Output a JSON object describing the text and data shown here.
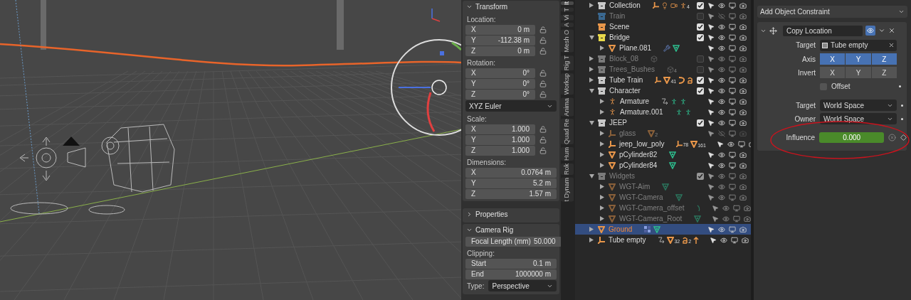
{
  "n_panel": {
    "panels": [
      {
        "title": "Transform",
        "expanded": true,
        "items": [
          {
            "kind": "label",
            "text": "Location:"
          },
          {
            "kind": "field",
            "label": "X",
            "value": "0 m",
            "locked": false
          },
          {
            "kind": "field",
            "label": "Y",
            "value": "-112.38 m",
            "locked": false
          },
          {
            "kind": "field",
            "label": "Z",
            "value": "0 m",
            "locked": false
          },
          {
            "kind": "label",
            "text": "Rotation:"
          },
          {
            "kind": "field",
            "label": "X",
            "value": "0°",
            "locked": false
          },
          {
            "kind": "field",
            "label": "Y",
            "value": "0°",
            "locked": false
          },
          {
            "kind": "field",
            "label": "Z",
            "value": "0°",
            "locked": false
          },
          {
            "kind": "dropdown",
            "value": "XYZ Euler"
          },
          {
            "kind": "label",
            "text": "Scale:"
          },
          {
            "kind": "field",
            "label": "X",
            "value": "1.000",
            "locked": false
          },
          {
            "kind": "field",
            "label": "Y",
            "value": "1.000",
            "locked": false
          },
          {
            "kind": "field",
            "label": "Z",
            "value": "1.000",
            "locked": false
          },
          {
            "kind": "label",
            "text": "Dimensions:"
          },
          {
            "kind": "field",
            "label": "X",
            "value": "0.0764 m"
          },
          {
            "kind": "field",
            "label": "Y",
            "value": "5.2 m"
          },
          {
            "kind": "field",
            "label": "Z",
            "value": "1.57 m"
          }
        ]
      },
      {
        "title": "Properties",
        "expanded": false
      },
      {
        "title": "Camera Rig",
        "expanded": true,
        "items": [
          {
            "kind": "field",
            "label": "Focal Length (mm)",
            "value": "50.000"
          },
          {
            "kind": "label",
            "text": "Clipping:"
          },
          {
            "kind": "field",
            "label": "Start",
            "value": "0.1 m"
          },
          {
            "kind": "field",
            "label": "End",
            "value": "1000000 m"
          },
          {
            "kind": "dropdown",
            "label": "Type:",
            "value": "Perspective"
          }
        ]
      }
    ],
    "tabs": [
      {
        "label": "It",
        "selected": true
      },
      {
        "label": "T",
        "selected": false
      },
      {
        "label": "Vi",
        "selected": false
      },
      {
        "label": "A",
        "selected": false
      },
      {
        "label": "Mesh O",
        "selected": false
      },
      {
        "label": "Rig T",
        "selected": false
      },
      {
        "label": "Worksp",
        "selected": false
      },
      {
        "label": "Anima",
        "selected": false
      },
      {
        "label": "Quad Re",
        "selected": false
      },
      {
        "label": "Hum",
        "selected": false
      },
      {
        "label": "Rok",
        "selected": false
      },
      {
        "label": "t Dynam",
        "selected": false
      }
    ]
  },
  "outliner": {
    "rows": [
      {
        "name": "Collection",
        "kind": "collection",
        "color": "#c8c8c8",
        "expanded": false,
        "checked": true,
        "visible": true,
        "render": true,
        "dim": false,
        "selected": false,
        "extras": [
          {
            "kind": "axes"
          },
          {
            "kind": "bulb"
          },
          {
            "kind": "camera"
          },
          {
            "kind": "figure",
            "count": "4"
          }
        ]
      },
      {
        "name": "Train",
        "kind": "collection",
        "color": "#3a6890",
        "checked": false,
        "visible": false,
        "render": true,
        "dim": true,
        "selected": false
      },
      {
        "name": "Scene",
        "kind": "collection",
        "color": "#e8964a",
        "checked": true,
        "visible": true,
        "render": true,
        "dim": false,
        "selected": false
      },
      {
        "name": "Bridge",
        "kind": "collection",
        "color": "#e8d84a",
        "expanded": true,
        "checked": true,
        "visible": true,
        "render": true,
        "dim": false,
        "selected": false,
        "children": [
          {
            "name": "Plane.081",
            "kind": "mesh",
            "expanded": false,
            "visible": true,
            "render": true,
            "dim": false,
            "selected": false,
            "extras": [
              {
                "kind": "wrench"
              },
              {
                "kind": "mesh_data"
              }
            ]
          }
        ]
      },
      {
        "name": "Block_08",
        "kind": "collection",
        "color": "#7a7a7a",
        "expanded": false,
        "checked": false,
        "visible": true,
        "render": true,
        "dim": true,
        "selected": false,
        "extras": [
          {
            "kind": "box"
          }
        ]
      },
      {
        "name": "Trees_Bushes",
        "kind": "collection",
        "color": "#7a7a7a",
        "expanded": false,
        "checked": false,
        "visible": true,
        "render": true,
        "dim": true,
        "selected": false,
        "extras": [
          {
            "kind": "box",
            "count": "4"
          }
        ]
      },
      {
        "name": "Tube Train",
        "kind": "collection",
        "color": "#c8c8c8",
        "expanded": false,
        "checked": true,
        "visible": true,
        "render": true,
        "dim": false,
        "selected": false,
        "extras": [
          {
            "kind": "axes"
          },
          {
            "kind": "triangle",
            "count": "41"
          },
          {
            "kind": "curve"
          },
          {
            "kind": "hook"
          }
        ]
      },
      {
        "name": "Character",
        "kind": "collection",
        "color": "#c8c8c8",
        "expanded": true,
        "checked": true,
        "visible": true,
        "render": true,
        "dim": false,
        "selected": false,
        "children": [
          {
            "name": "Armature",
            "kind": "armature",
            "expanded": false,
            "visible": true,
            "render": true,
            "dim": false,
            "selected": false,
            "extras": [
              {
                "kind": "path"
              },
              {
                "kind": "pose"
              },
              {
                "kind": "pose"
              }
            ]
          },
          {
            "name": "Armature.001",
            "kind": "armature",
            "expanded": false,
            "visible": true,
            "render": true,
            "dim": false,
            "selected": false,
            "extras": [
              {
                "kind": "pose"
              },
              {
                "kind": "pose"
              }
            ]
          }
        ]
      },
      {
        "name": "JEEP",
        "kind": "collection",
        "color": "#c8c8c8",
        "expanded": true,
        "checked": true,
        "visible": true,
        "render": true,
        "dim": false,
        "selected": false,
        "children": [
          {
            "name": "glass",
            "kind": "empty",
            "expanded": false,
            "visible": false,
            "render": false,
            "dim": true,
            "selected": false,
            "extras": [
              {
                "kind": "triangle",
                "count": "2"
              }
            ]
          },
          {
            "name": "jeep_low_poly",
            "kind": "empty",
            "expanded": false,
            "visible": true,
            "render": true,
            "dim": false,
            "selected": false,
            "extras": [
              {
                "kind": "axes",
                "count": "78"
              },
              {
                "kind": "triangle",
                "count": "161"
              }
            ]
          },
          {
            "name": "pCylinder82",
            "kind": "mesh",
            "expanded": false,
            "visible": true,
            "render": true,
            "dim": false,
            "selected": false,
            "extras": [
              {
                "kind": "mesh_data"
              }
            ]
          },
          {
            "name": "pCylinder84",
            "kind": "mesh",
            "expanded": false,
            "visible": true,
            "render": true,
            "dim": false,
            "selected": false,
            "extras": [
              {
                "kind": "mesh_data"
              }
            ]
          }
        ]
      },
      {
        "name": "Widgets",
        "kind": "collection",
        "color": "#7a7a7a",
        "expanded": true,
        "checked": true,
        "visible": true,
        "render": true,
        "dim": true,
        "selected": false,
        "children": [
          {
            "name": "WGT-Aim",
            "kind": "mesh",
            "expanded": false,
            "visible": true,
            "render": true,
            "dim": true,
            "selected": false,
            "extras": [
              {
                "kind": "mesh_data"
              }
            ]
          },
          {
            "name": "WGT-Camera",
            "kind": "mesh",
            "expanded": false,
            "visible": true,
            "render": true,
            "dim": true,
            "selected": false,
            "extras": [
              {
                "kind": "mesh_data"
              }
            ]
          },
          {
            "name": "WGT-Camera_offset",
            "kind": "mesh",
            "expanded": false,
            "visible": true,
            "render": true,
            "dim": true,
            "selected": false,
            "extras": [
              {
                "kind": "curve_data"
              }
            ]
          },
          {
            "name": "WGT-Camera_Root",
            "kind": "mesh",
            "expanded": false,
            "visible": true,
            "render": true,
            "dim": true,
            "selected": false,
            "extras": [
              {
                "kind": "mesh_data"
              }
            ]
          }
        ]
      },
      {
        "name": "Ground",
        "kind": "mesh",
        "expanded": false,
        "visible": true,
        "render": true,
        "dim": false,
        "selected": true,
        "extras": [
          {
            "kind": "material"
          },
          {
            "kind": "mesh_data"
          }
        ]
      },
      {
        "name": "Tube empty",
        "kind": "empty",
        "expanded": false,
        "visible": true,
        "render": true,
        "dim": false,
        "selected": false,
        "extras": [
          {
            "kind": "path"
          },
          {
            "kind": "triangle",
            "count": "32"
          },
          {
            "kind": "hook",
            "count": "2"
          },
          {
            "kind": "arrow"
          }
        ]
      }
    ]
  },
  "properties": {
    "add_constraint": "Add Object Constraint",
    "constraint": {
      "name": "Copy Location",
      "expanded": true,
      "enabled": true,
      "target": {
        "label": "Target",
        "value": "Tube empty"
      },
      "axis": {
        "label": "Axis",
        "toggles": [
          {
            "label": "X",
            "selected": true
          },
          {
            "label": "Y",
            "selected": true
          },
          {
            "label": "Z",
            "selected": true
          }
        ]
      },
      "invert": {
        "label": "Invert",
        "toggles": [
          {
            "label": "X",
            "selected": false
          },
          {
            "label": "Y",
            "selected": false
          },
          {
            "label": "Z",
            "selected": false
          }
        ]
      },
      "offset": {
        "label": "Offset",
        "checked": false
      },
      "spaces": [
        {
          "label": "Target",
          "value": "World Space"
        },
        {
          "label": "Owner",
          "value": "World Space"
        }
      ],
      "influence": {
        "label": "Influence",
        "value": "0.000",
        "animated": true
      }
    }
  }
}
